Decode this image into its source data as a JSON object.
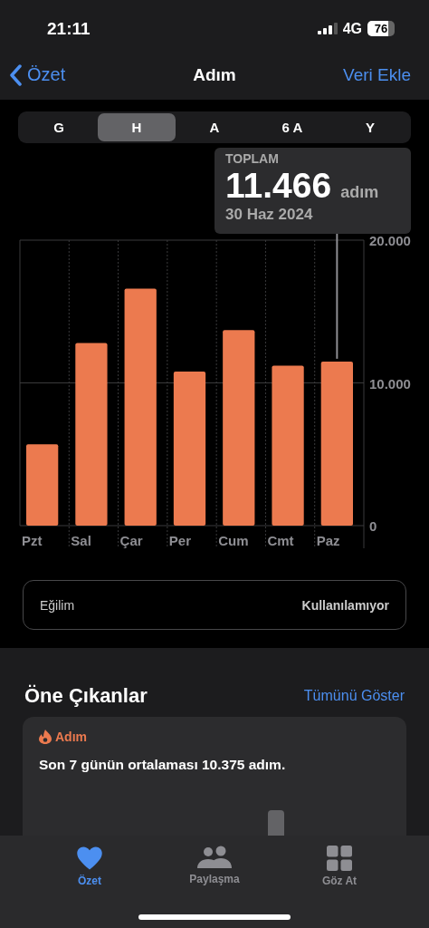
{
  "status_bar": {
    "time": "21:11",
    "network": "4G",
    "battery": "76"
  },
  "nav": {
    "back": "Özet",
    "title": "Adım",
    "action": "Veri Ekle"
  },
  "ranges": [
    {
      "label": "G",
      "selected": false
    },
    {
      "label": "H",
      "selected": true
    },
    {
      "label": "A",
      "selected": false
    },
    {
      "label": "6 A",
      "selected": false
    },
    {
      "label": "Y",
      "selected": false
    }
  ],
  "chart_data": {
    "type": "bar",
    "categories": [
      "Pzt",
      "Sal",
      "Çar",
      "Per",
      "Cum",
      "Cmt",
      "Paz"
    ],
    "series": [
      {
        "color": "#ec7a4f",
        "values": [
          5700,
          12800,
          16600,
          10800,
          13700,
          11200,
          11500
        ]
      }
    ],
    "ylim": [
      0,
      20000
    ],
    "yticks": [
      {
        "value": 0,
        "label": "0"
      },
      {
        "value": 10000,
        "label": "10.000"
      },
      {
        "value": 20000,
        "label": "20.000"
      }
    ]
  },
  "selection": {
    "label": "TOPLAM",
    "value": "11.466",
    "unit": "adım",
    "date": "30 Haz 2024"
  },
  "trend": {
    "label": "Eğilim",
    "value": "Kullanılamıyor"
  },
  "highlights": {
    "title": "Öne Çıkanlar",
    "action": "Tümünü Göster",
    "card": {
      "category": "Adım",
      "text": "Son 7 günün ortalaması 10.375 adım."
    }
  },
  "tab_bar": [
    {
      "label": "Özet",
      "kind": "heart",
      "selected": true
    },
    {
      "label": "Paylaşma",
      "kind": "people",
      "selected": false
    },
    {
      "label": "Göz At",
      "kind": "grid",
      "selected": false
    }
  ]
}
